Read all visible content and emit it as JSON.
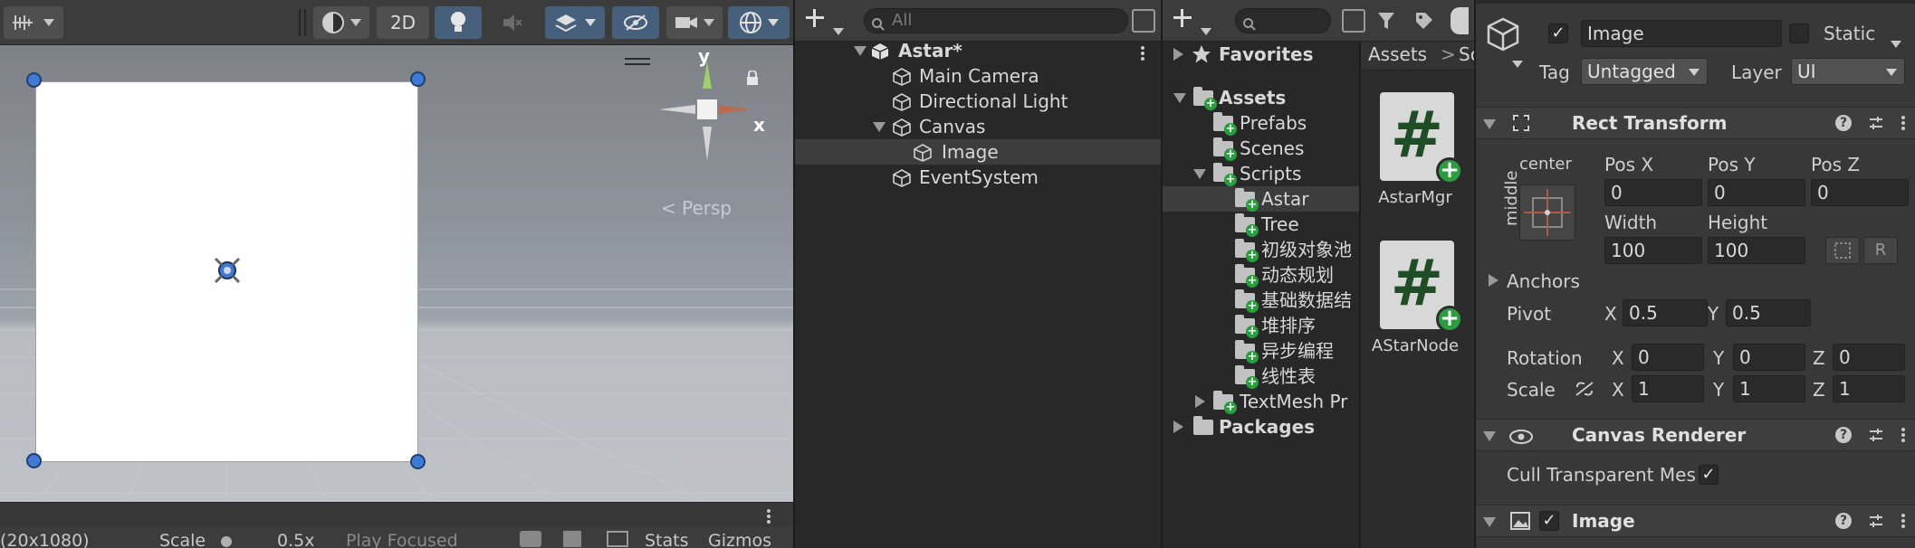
{
  "scene": {
    "toolbar": {
      "mode_2d_label": "2D"
    },
    "gizmo": {
      "y_label": "y",
      "x_label": "x",
      "persp_label": "< Persp"
    },
    "bottom_bar": {
      "resolution": "(20x1080)",
      "scale_label": "Scale",
      "scale_value": "0.5x",
      "play_focused": "Play Focused",
      "stats_label": "Stats",
      "gizmos_label": "Gizmos"
    }
  },
  "hierarchy": {
    "search_placeholder": "All",
    "items": [
      {
        "label": "Astar*"
      },
      {
        "label": "Main Camera"
      },
      {
        "label": "Directional Light"
      },
      {
        "label": "Canvas"
      },
      {
        "label": "Image"
      },
      {
        "label": "EventSystem"
      }
    ]
  },
  "project": {
    "favorites_label": "Favorites",
    "assets_label": "Assets",
    "folders": [
      {
        "label": "Prefabs"
      },
      {
        "label": "Scenes"
      },
      {
        "label": "Scripts"
      },
      {
        "label": "Astar"
      },
      {
        "label": "Tree"
      },
      {
        "label": "初级对象池"
      },
      {
        "label": "动态规划"
      },
      {
        "label": "基础数据结"
      },
      {
        "label": "堆排序"
      },
      {
        "label": "异步编程"
      },
      {
        "label": "线性表"
      },
      {
        "label": "TextMesh Pr"
      }
    ],
    "packages_label": "Packages",
    "breadcrumb": {
      "root": "Assets",
      "sep": ">",
      "next": "Sc"
    },
    "files": [
      {
        "label": "AstarMgr"
      },
      {
        "label": "AStarNode"
      }
    ]
  },
  "inspector": {
    "object_name": "Image",
    "static_label": "Static",
    "tag_label": "Tag",
    "tag_value": "Untagged",
    "layer_label": "Layer",
    "layer_value": "UI",
    "rect_transform": {
      "title": "Rect Transform",
      "anchor_h": "center",
      "anchor_v": "middle",
      "pos_x_label": "Pos X",
      "pos_y_label": "Pos Y",
      "pos_z_label": "Pos Z",
      "pos_x": "0",
      "pos_y": "0",
      "pos_z": "0",
      "width_label": "Width",
      "height_label": "Height",
      "width": "100",
      "height": "100",
      "r_label": "R",
      "anchors_label": "Anchors",
      "pivot_label": "Pivot",
      "pivot_x": "0.5",
      "pivot_y": "0.5",
      "rotation_label": "Rotation",
      "rot_x": "0",
      "rot_y": "0",
      "rot_z": "0",
      "scale_label": "Scale",
      "scale_x": "1",
      "scale_y": "1",
      "scale_z": "1",
      "x": "X",
      "y": "Y",
      "z": "Z"
    },
    "canvas_renderer": {
      "title": "Canvas Renderer",
      "cull_label": "Cull Transparent Mes"
    },
    "image_component": {
      "title": "Image"
    }
  },
  "colors": {
    "accent_blue": "#46607c",
    "selection": "#3d3d3d",
    "badge_green": "#2a9d3f"
  }
}
